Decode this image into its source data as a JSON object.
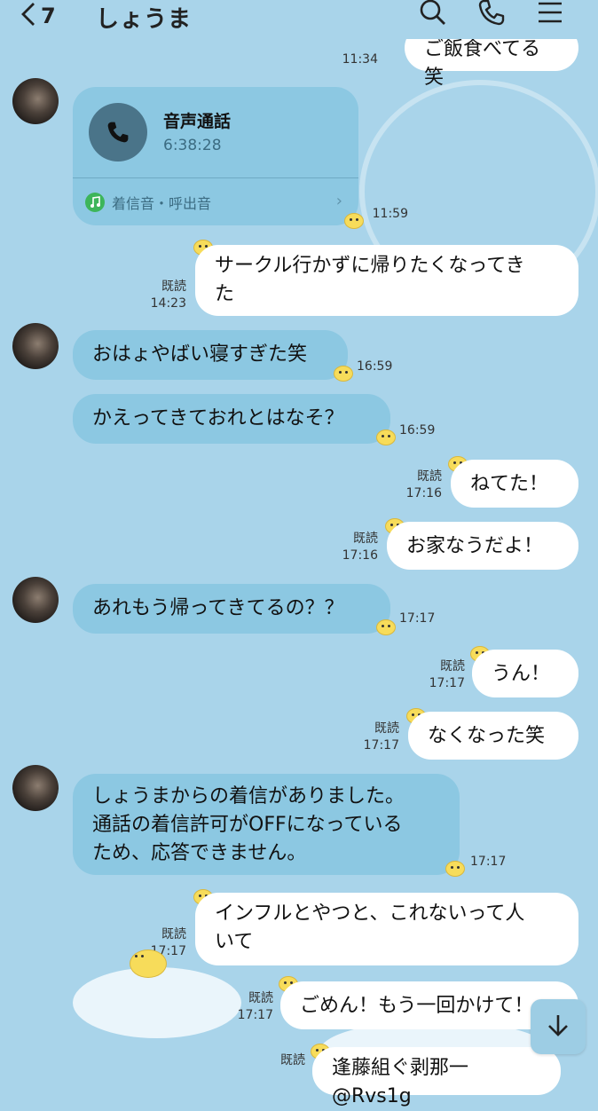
{
  "header": {
    "back_count": "7",
    "title": "しょうま"
  },
  "call_card": {
    "title": "音声通話",
    "duration": "6:38:28",
    "ringtone_label": "着信音・呼出音",
    "time": "11:59"
  },
  "messages": [
    {
      "id": "m0",
      "direction": "out",
      "text": "ご飯食べてる笑",
      "time": "11:34",
      "read": ""
    },
    {
      "id": "m1",
      "direction": "out",
      "text": "サークル行かずに帰りたくなってき\nた",
      "time": "14:23",
      "read": "既読"
    },
    {
      "id": "m2",
      "direction": "in",
      "text": "おはょやばい寝すぎた笑",
      "time": "16:59"
    },
    {
      "id": "m3",
      "direction": "in",
      "text": "かえってきておれとはなそ？",
      "time": "16:59"
    },
    {
      "id": "m4",
      "direction": "out",
      "text": "ねてた！",
      "time": "17:16",
      "read": "既読"
    },
    {
      "id": "m5",
      "direction": "out",
      "text": "お家なうだよ！",
      "time": "17:16",
      "read": "既読"
    },
    {
      "id": "m6",
      "direction": "in",
      "text": "あれもう帰ってきてるの？？",
      "time": "17:17"
    },
    {
      "id": "m7",
      "direction": "out",
      "text": "うん！",
      "time": "17:17",
      "read": "既読"
    },
    {
      "id": "m8",
      "direction": "out",
      "text": "なくなった笑",
      "time": "17:17",
      "read": "既読"
    },
    {
      "id": "m9",
      "direction": "in",
      "text": "しょうまからの着信がありました。\n通話の着信許可がOFFになっている\nため、応答できません。",
      "time": "17:17"
    },
    {
      "id": "m10",
      "direction": "out",
      "text": "インフルとやつと、これないって人\nいて",
      "time": "17:17",
      "read": "既読"
    },
    {
      "id": "m11",
      "direction": "out",
      "text": "ごめん！もう一回かけて！",
      "time": "17:17",
      "read": "既読"
    },
    {
      "id": "m12",
      "direction": "out",
      "text": "逢藤組ぐ剥那一@Rvs1g",
      "time": "",
      "read": "既読"
    }
  ],
  "colors": {
    "background": "#a9d4ea",
    "incoming_bubble": "#8cc8e2",
    "outgoing_bubble": "#ffffff"
  },
  "icons": {
    "back": "chevron-left-icon",
    "search": "search-icon",
    "call": "phone-icon",
    "menu": "hamburger-menu-icon",
    "scroll_down": "arrow-down-icon"
  }
}
